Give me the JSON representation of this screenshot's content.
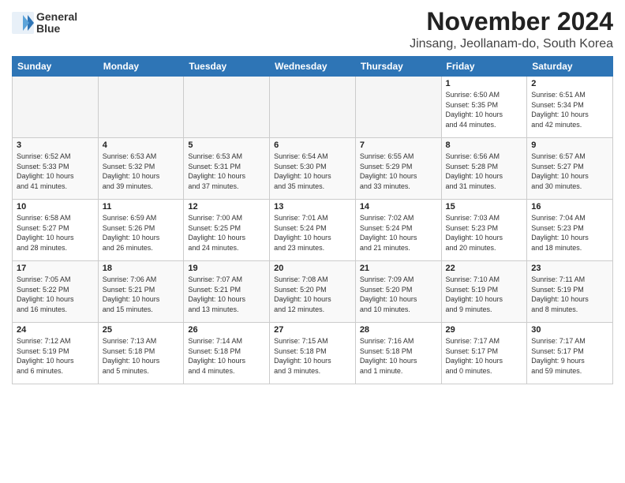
{
  "header": {
    "logo_line1": "General",
    "logo_line2": "Blue",
    "month": "November 2024",
    "location": "Jinsang, Jeollanam-do, South Korea"
  },
  "weekdays": [
    "Sunday",
    "Monday",
    "Tuesday",
    "Wednesday",
    "Thursday",
    "Friday",
    "Saturday"
  ],
  "weeks": [
    [
      {
        "day": "",
        "info": ""
      },
      {
        "day": "",
        "info": ""
      },
      {
        "day": "",
        "info": ""
      },
      {
        "day": "",
        "info": ""
      },
      {
        "day": "",
        "info": ""
      },
      {
        "day": "1",
        "info": "Sunrise: 6:50 AM\nSunset: 5:35 PM\nDaylight: 10 hours\nand 44 minutes."
      },
      {
        "day": "2",
        "info": "Sunrise: 6:51 AM\nSunset: 5:34 PM\nDaylight: 10 hours\nand 42 minutes."
      }
    ],
    [
      {
        "day": "3",
        "info": "Sunrise: 6:52 AM\nSunset: 5:33 PM\nDaylight: 10 hours\nand 41 minutes."
      },
      {
        "day": "4",
        "info": "Sunrise: 6:53 AM\nSunset: 5:32 PM\nDaylight: 10 hours\nand 39 minutes."
      },
      {
        "day": "5",
        "info": "Sunrise: 6:53 AM\nSunset: 5:31 PM\nDaylight: 10 hours\nand 37 minutes."
      },
      {
        "day": "6",
        "info": "Sunrise: 6:54 AM\nSunset: 5:30 PM\nDaylight: 10 hours\nand 35 minutes."
      },
      {
        "day": "7",
        "info": "Sunrise: 6:55 AM\nSunset: 5:29 PM\nDaylight: 10 hours\nand 33 minutes."
      },
      {
        "day": "8",
        "info": "Sunrise: 6:56 AM\nSunset: 5:28 PM\nDaylight: 10 hours\nand 31 minutes."
      },
      {
        "day": "9",
        "info": "Sunrise: 6:57 AM\nSunset: 5:27 PM\nDaylight: 10 hours\nand 30 minutes."
      }
    ],
    [
      {
        "day": "10",
        "info": "Sunrise: 6:58 AM\nSunset: 5:27 PM\nDaylight: 10 hours\nand 28 minutes."
      },
      {
        "day": "11",
        "info": "Sunrise: 6:59 AM\nSunset: 5:26 PM\nDaylight: 10 hours\nand 26 minutes."
      },
      {
        "day": "12",
        "info": "Sunrise: 7:00 AM\nSunset: 5:25 PM\nDaylight: 10 hours\nand 24 minutes."
      },
      {
        "day": "13",
        "info": "Sunrise: 7:01 AM\nSunset: 5:24 PM\nDaylight: 10 hours\nand 23 minutes."
      },
      {
        "day": "14",
        "info": "Sunrise: 7:02 AM\nSunset: 5:24 PM\nDaylight: 10 hours\nand 21 minutes."
      },
      {
        "day": "15",
        "info": "Sunrise: 7:03 AM\nSunset: 5:23 PM\nDaylight: 10 hours\nand 20 minutes."
      },
      {
        "day": "16",
        "info": "Sunrise: 7:04 AM\nSunset: 5:23 PM\nDaylight: 10 hours\nand 18 minutes."
      }
    ],
    [
      {
        "day": "17",
        "info": "Sunrise: 7:05 AM\nSunset: 5:22 PM\nDaylight: 10 hours\nand 16 minutes."
      },
      {
        "day": "18",
        "info": "Sunrise: 7:06 AM\nSunset: 5:21 PM\nDaylight: 10 hours\nand 15 minutes."
      },
      {
        "day": "19",
        "info": "Sunrise: 7:07 AM\nSunset: 5:21 PM\nDaylight: 10 hours\nand 13 minutes."
      },
      {
        "day": "20",
        "info": "Sunrise: 7:08 AM\nSunset: 5:20 PM\nDaylight: 10 hours\nand 12 minutes."
      },
      {
        "day": "21",
        "info": "Sunrise: 7:09 AM\nSunset: 5:20 PM\nDaylight: 10 hours\nand 10 minutes."
      },
      {
        "day": "22",
        "info": "Sunrise: 7:10 AM\nSunset: 5:19 PM\nDaylight: 10 hours\nand 9 minutes."
      },
      {
        "day": "23",
        "info": "Sunrise: 7:11 AM\nSunset: 5:19 PM\nDaylight: 10 hours\nand 8 minutes."
      }
    ],
    [
      {
        "day": "24",
        "info": "Sunrise: 7:12 AM\nSunset: 5:19 PM\nDaylight: 10 hours\nand 6 minutes."
      },
      {
        "day": "25",
        "info": "Sunrise: 7:13 AM\nSunset: 5:18 PM\nDaylight: 10 hours\nand 5 minutes."
      },
      {
        "day": "26",
        "info": "Sunrise: 7:14 AM\nSunset: 5:18 PM\nDaylight: 10 hours\nand 4 minutes."
      },
      {
        "day": "27",
        "info": "Sunrise: 7:15 AM\nSunset: 5:18 PM\nDaylight: 10 hours\nand 3 minutes."
      },
      {
        "day": "28",
        "info": "Sunrise: 7:16 AM\nSunset: 5:18 PM\nDaylight: 10 hours\nand 1 minute."
      },
      {
        "day": "29",
        "info": "Sunrise: 7:17 AM\nSunset: 5:17 PM\nDaylight: 10 hours\nand 0 minutes."
      },
      {
        "day": "30",
        "info": "Sunrise: 7:17 AM\nSunset: 5:17 PM\nDaylight: 9 hours\nand 59 minutes."
      }
    ]
  ]
}
